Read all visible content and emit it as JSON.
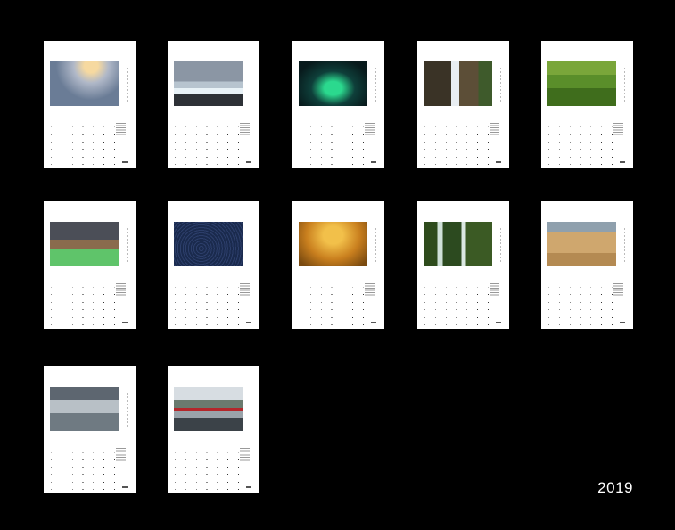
{
  "year_label": "2019",
  "pages": [
    {
      "id": "page-1",
      "photo": "snowy-mountain-sunrise-lake"
    },
    {
      "id": "page-2",
      "photo": "ice-blocks-on-beach"
    },
    {
      "id": "page-3",
      "photo": "green-aurora-over-water"
    },
    {
      "id": "page-4",
      "photo": "waterfall-in-cave"
    },
    {
      "id": "page-5",
      "photo": "green-rolling-hills"
    },
    {
      "id": "page-6",
      "photo": "mountain-towers-with-green-lake"
    },
    {
      "id": "page-7",
      "photo": "star-trails-night-sky"
    },
    {
      "id": "page-8",
      "photo": "misty-golden-forest"
    },
    {
      "id": "page-9",
      "photo": "mossy-cascades"
    },
    {
      "id": "page-10",
      "photo": "golden-plowed-fields"
    },
    {
      "id": "page-11",
      "photo": "glacier-ice-cave"
    },
    {
      "id": "page-12",
      "photo": "red-cabin-in-snowy-forest"
    }
  ]
}
